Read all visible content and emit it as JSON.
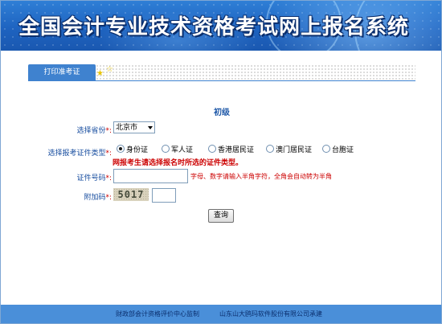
{
  "banner": {
    "title": "全国会计专业技术资格考试网上报名系统"
  },
  "tabs": {
    "active_label": "打印准考证"
  },
  "form": {
    "heading": "初级",
    "province": {
      "label": "选择省份",
      "required_mark": "*:",
      "value": "北京市"
    },
    "id_type": {
      "label": "选择报考证件类型",
      "required_mark": "*:",
      "options": [
        "身份证",
        "军人证",
        "香港居民证",
        "澳门居民证",
        "台胞证"
      ],
      "selected": "身份证",
      "warning": "网报考生请选择报名时所选的证件类型。"
    },
    "id_number": {
      "label": "证件号码",
      "required_mark": "*:",
      "value": "",
      "hint": "字母、数字请输入半角字符，全角会自动转为半角"
    },
    "captcha": {
      "label": "附加码",
      "required_mark": "*:",
      "image_text": "5017",
      "value": ""
    },
    "submit_label": "查询"
  },
  "footer": {
    "left": "财政部会计资格评价中心监制",
    "right": "山东山大鸥玛软件股份有限公司承建"
  },
  "colors": {
    "banner": "#1e63c0",
    "tab": "#3f82cf",
    "label": "#1a4fa0",
    "warning": "#cc0000",
    "footer": "#4a8fd9"
  }
}
